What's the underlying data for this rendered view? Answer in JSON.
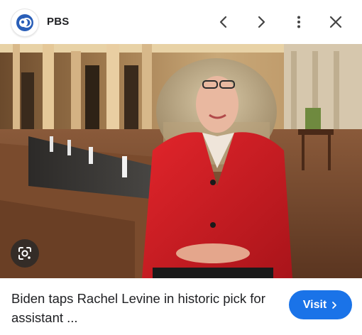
{
  "header": {
    "source_name": "PBS",
    "logo_icon": "pbs-logo-icon",
    "controls": [
      "chevron-left-icon",
      "chevron-right-icon",
      "more-vert-icon",
      "close-icon"
    ]
  },
  "image": {
    "lens_icon": "lens-search-icon"
  },
  "caption": {
    "title": "Biden taps Rachel Levine in historic pick for assistant ..."
  },
  "visit_button": {
    "label": "Visit",
    "icon": "chevron-right-icon",
    "color": "#1a73e8"
  }
}
